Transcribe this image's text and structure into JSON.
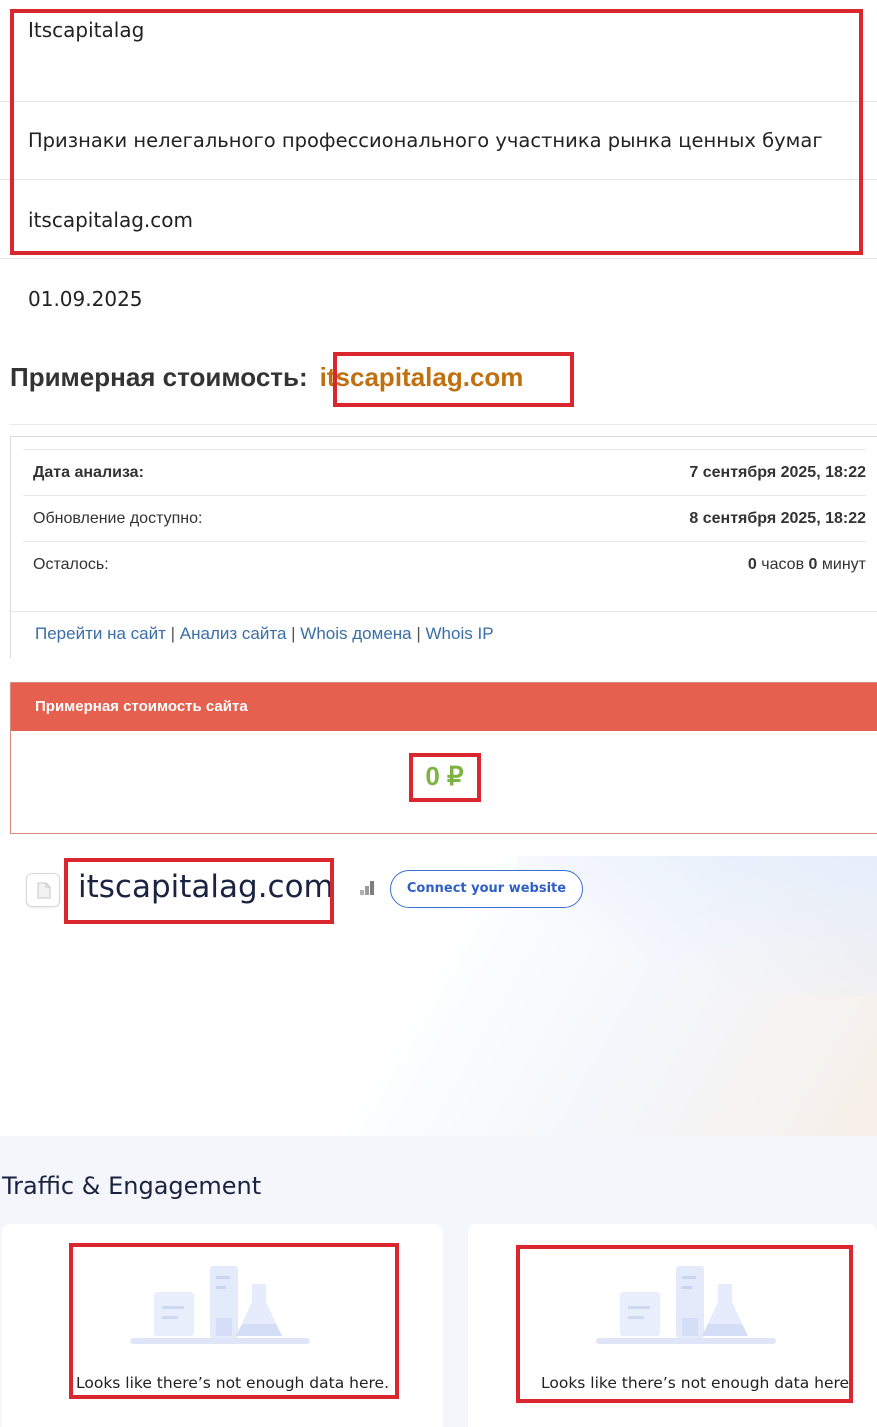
{
  "info": {
    "name": "Itscapitalag",
    "reason": "Признаки нелегального профессионального участника рынка ценных бумаг",
    "domain": "itscapitalag.com",
    "date": "01.09.2025"
  },
  "cost_heading": {
    "label": "Примерная стоимость:",
    "domain": "itscapitalag.com"
  },
  "analysis": {
    "rows": [
      {
        "label": "Дата анализа:",
        "value": "7 сентября 2025, 18:22"
      },
      {
        "label": "Обновление доступно:",
        "value": "8 сентября 2025, 18:22"
      },
      {
        "label": "Осталось:",
        "hours": "0",
        "hours_unit": "часов",
        "minutes": "0",
        "minutes_unit": "минут"
      }
    ],
    "links": [
      "Перейти на сайт",
      "Анализ сайта",
      "Whois домена",
      "Whois IP"
    ],
    "separator": "|"
  },
  "cost_panel": {
    "title": "Примерная стоимость сайта",
    "value": "0 ₽"
  },
  "site_card": {
    "domain": "itscapitalag.com",
    "connect_label": "Connect your website"
  },
  "traffic": {
    "title": "Traffic & Engagement",
    "empty_message_1": "Looks like there’s not enough data here.",
    "empty_message_2": "Looks like there’s not enough data here."
  },
  "colors": {
    "highlight_border": "#d9262f",
    "cost_domain": "#c0700e",
    "panel_header": "#e5604e",
    "cost_value": "#7cb342",
    "link": "#3a6ea5",
    "connect": "#2e5fc7"
  },
  "icons": [
    "file-icon",
    "rank-bars-icon",
    "lab-flasks-illustration"
  ]
}
